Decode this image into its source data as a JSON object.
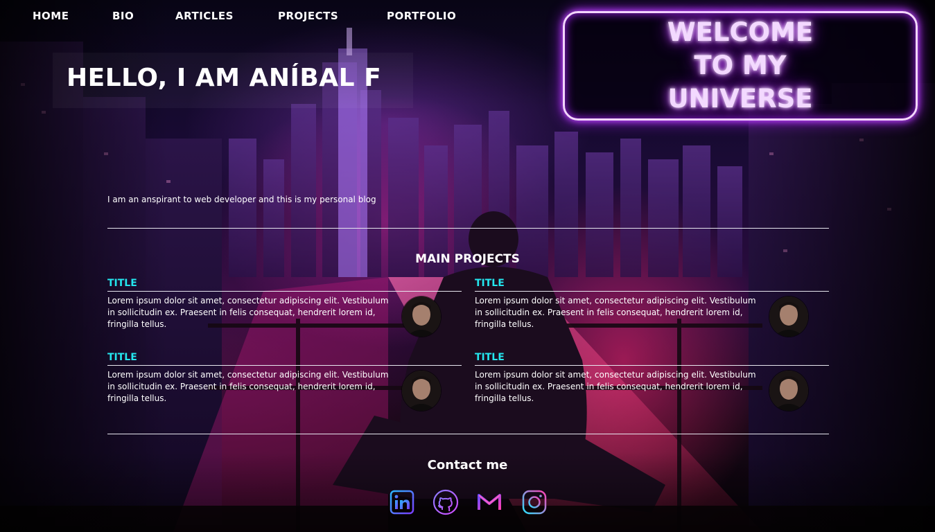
{
  "nav": {
    "items": [
      {
        "label": "HOME"
      },
      {
        "label": "BIO"
      },
      {
        "label": "ARTICLES"
      },
      {
        "label": "PROJECTS"
      },
      {
        "label": "PORTFOLIO"
      }
    ]
  },
  "welcome": {
    "lines": [
      "WELCOME",
      "TO MY",
      "UNIVERSE"
    ],
    "glow_color": "#c24dff"
  },
  "hero": {
    "title": "HELLO, I AM ANÍBAL F",
    "intro": "I am an anspirant to web developer and this is my personal blog"
  },
  "projects": {
    "heading": "MAIN PROJECTS",
    "title_color": "#24e6ee",
    "items": [
      {
        "title": "TITLE",
        "description": "Lorem ipsum dolor sit amet, consectetur adipiscing elit. Vestibulum in sollicitudin ex. Praesent in felis consequat, hendrerit lorem id, fringilla tellus."
      },
      {
        "title": "TITLE",
        "description": "Lorem ipsum dolor sit amet, consectetur adipiscing elit. Vestibulum in sollicitudin ex. Praesent in felis consequat, hendrerit lorem id, fringilla tellus."
      },
      {
        "title": "TITLE",
        "description": "Lorem ipsum dolor sit amet, consectetur adipiscing elit. Vestibulum in sollicitudin ex. Praesent in felis consequat, hendrerit lorem id, fringilla tellus."
      },
      {
        "title": "TITLE",
        "description": "Lorem ipsum dolor sit amet, consectetur adipiscing elit. Vestibulum in sollicitudin ex. Praesent in felis consequat, hendrerit lorem id, fringilla tellus."
      }
    ]
  },
  "contact": {
    "heading": "Contact me",
    "socials": [
      {
        "icon": "linkedin-icon"
      },
      {
        "icon": "github-icon"
      },
      {
        "icon": "gmail-icon"
      },
      {
        "icon": "instagram-icon"
      }
    ]
  }
}
